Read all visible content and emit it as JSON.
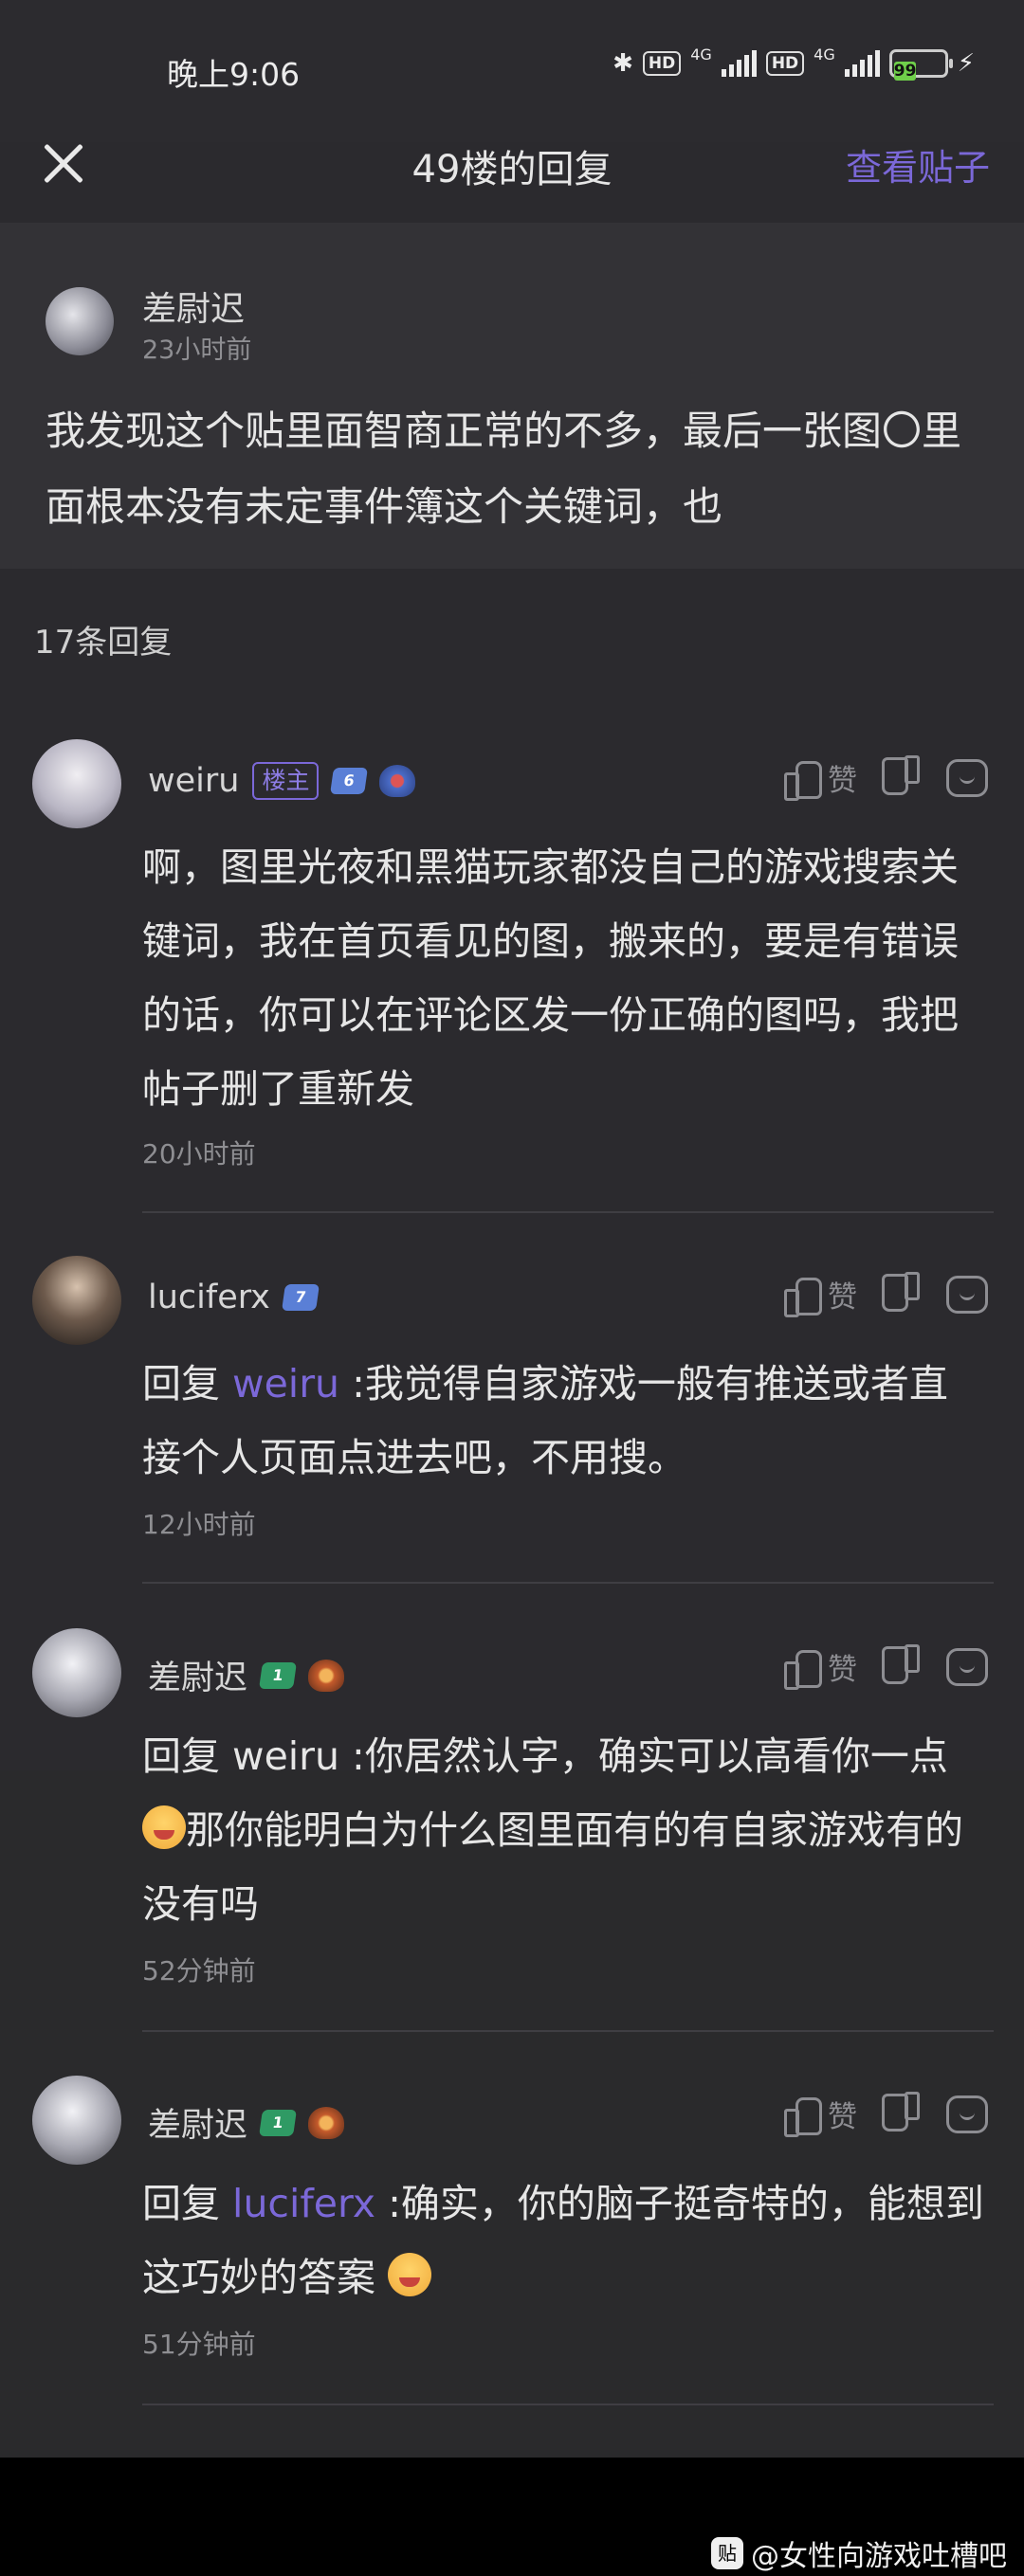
{
  "status": {
    "time": "晚上9:06",
    "hd1": "HD",
    "net1": "4G",
    "hd2": "HD",
    "net2": "4G",
    "battery": "99"
  },
  "nav": {
    "title": "49楼的回复",
    "view_post": "查看贴子"
  },
  "op": {
    "name": "差尉迟",
    "time": "23小时前",
    "text": "我发现这个贴里面智商正常的不多，最后一张图〇里面根本没有未定事件簿这个关键词，也"
  },
  "reply_count": "17条回复",
  "like_label": "赞",
  "replies": [
    {
      "name": "weiru",
      "owner_tag": "楼主",
      "level": "6",
      "text": "啊，图里光夜和黑猫玩家都没自己的游戏搜索关键词，我在首页看见的图，搬来的，要是有错误的话，你可以在评论区发一份正确的图吗，我把帖子删了重新发",
      "time": "20小时前"
    },
    {
      "name": "luciferx",
      "level": "7",
      "prefix": "回复 ",
      "mention": "weiru",
      "text": " :我觉得自家游戏一般有推送或者直接个人页面点进去吧，不用搜。",
      "time": "12小时前"
    },
    {
      "name": "差尉迟",
      "level": "1",
      "prefix": "回复 weiru :你居然认字，确实可以高看你一点 ",
      "text": "那你能明白为什么图里面有的有自家游戏有的没有吗",
      "time": "52分钟前"
    },
    {
      "name": "差尉迟",
      "level": "1",
      "prefix": "回复 ",
      "mention": "luciferx",
      "text": " :确实，你的脑子挺奇特的，能想到这巧妙的答案 ",
      "time": "51分钟前"
    }
  ],
  "watermark": {
    "logo": "贴",
    "text": "@女性向游戏吐槽吧"
  },
  "colors": {
    "accent": "#7b68d8",
    "background": "#2b2a2e"
  }
}
